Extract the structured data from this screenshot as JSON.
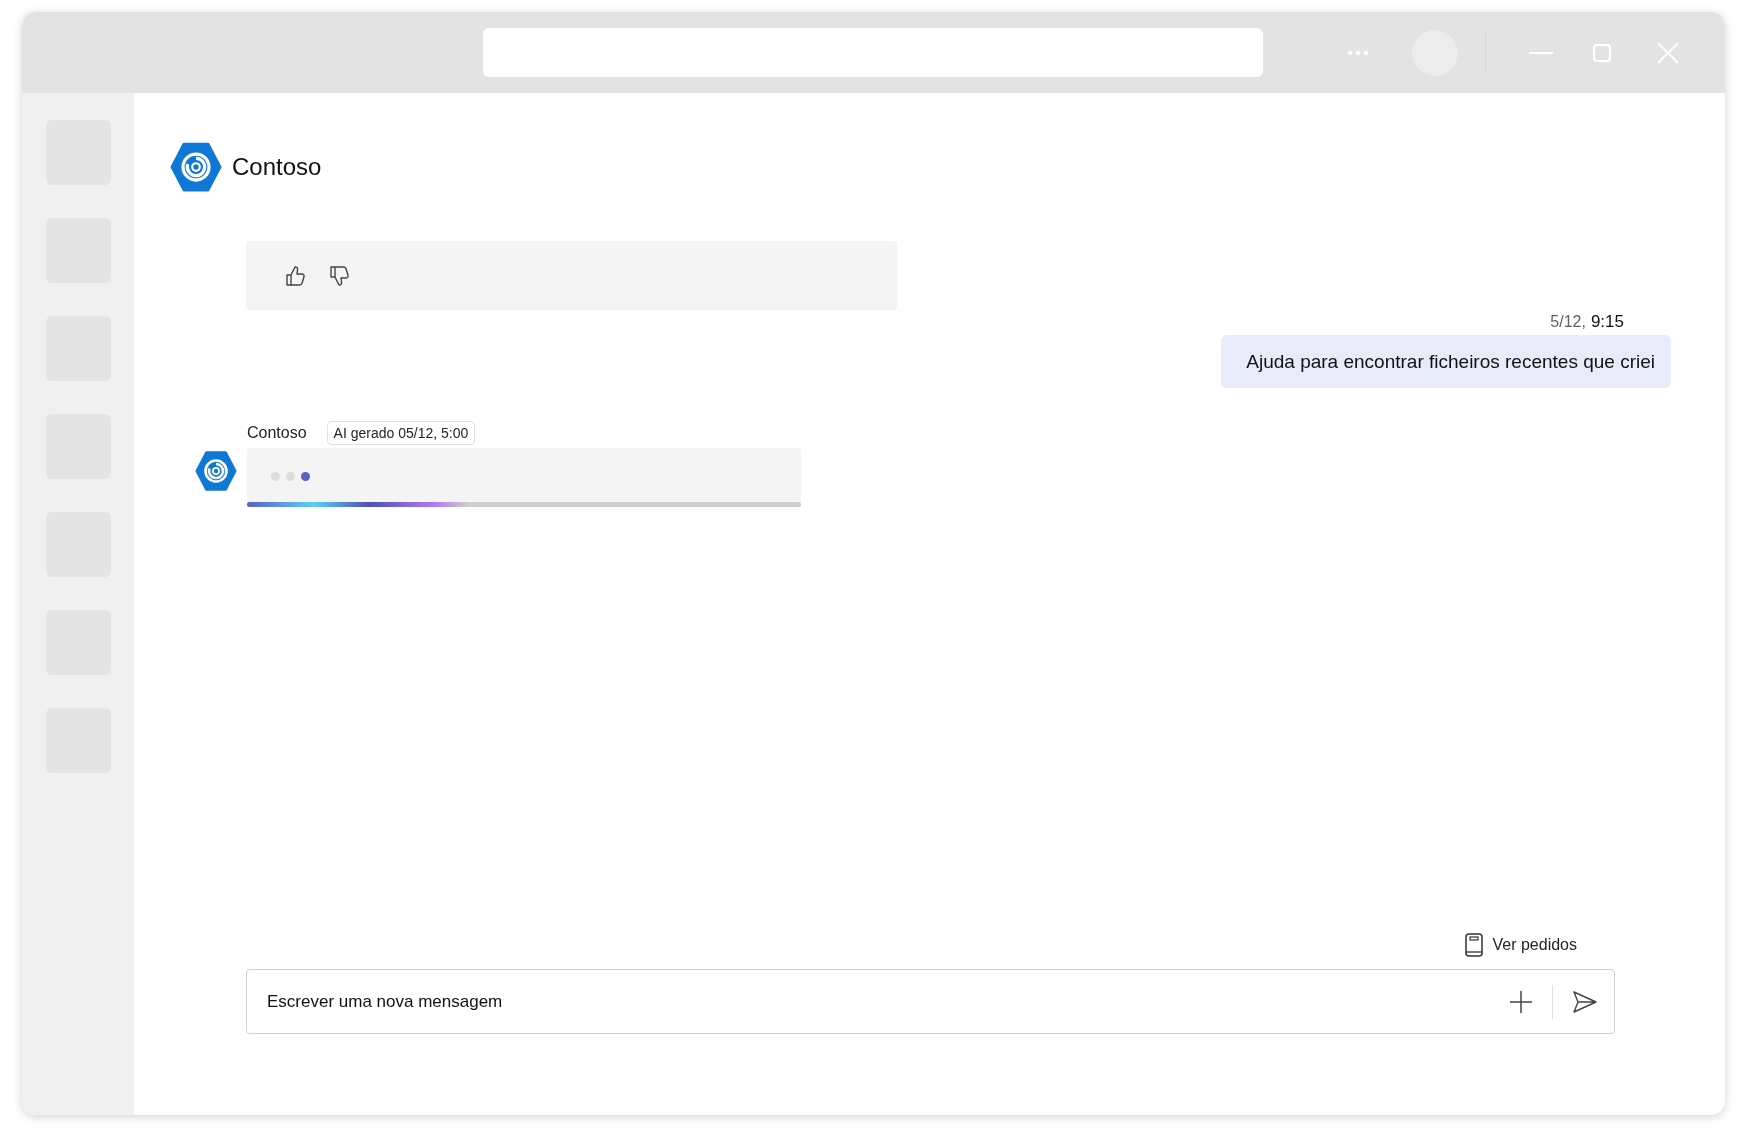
{
  "app": {
    "name": "Contoso"
  },
  "sidebar": {
    "items": [
      {
        "selected": false
      },
      {
        "selected": false
      },
      {
        "selected": false
      },
      {
        "selected": false
      },
      {
        "selected": false
      },
      {
        "selected": false
      },
      {
        "selected": false
      }
    ]
  },
  "messages": [
    {
      "kind": "feedback"
    },
    {
      "kind": "user",
      "date": "5/12,",
      "time": "9:15",
      "text": "Ajuda para encontrar ficheiros recentes que criei"
    },
    {
      "kind": "bot",
      "sender": "Contoso",
      "badge": "AI gerado 05/12, 5:00",
      "dots": [
        {
          "on": false
        },
        {
          "on": false
        },
        {
          "on": true
        }
      ],
      "level": 0.4
    }
  ],
  "prompts_link": "Ver pedidos",
  "composer": {
    "placeholder": "Escrever uma nova mensagem"
  }
}
